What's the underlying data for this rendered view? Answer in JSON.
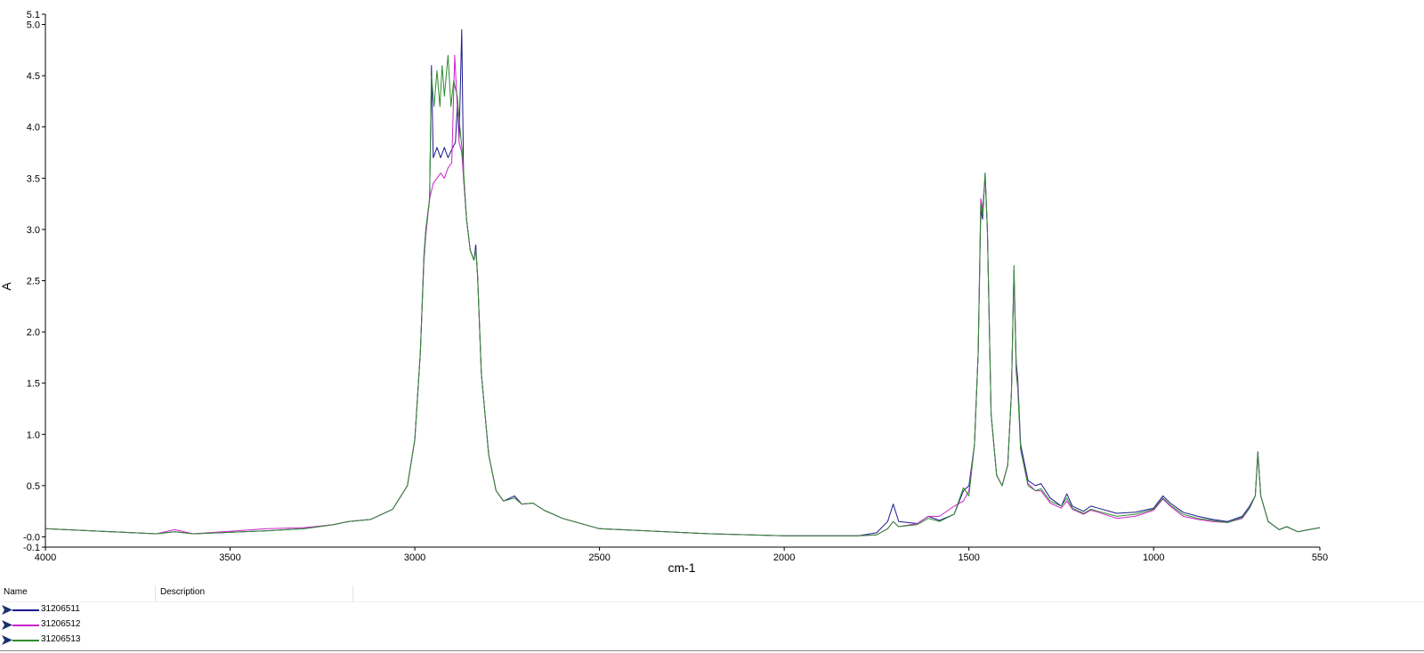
{
  "chart_data": {
    "type": "line",
    "xlabel": "cm-1",
    "ylabel": "A",
    "xlim": [
      4000,
      550
    ],
    "ylim": [
      -0.1,
      5.1
    ],
    "x_reversed": true,
    "xticks": [
      4000,
      3500,
      3000,
      2500,
      2000,
      1500,
      1000,
      550
    ],
    "xtick_labels": [
      "4000",
      "3500",
      "3000",
      "2500",
      "2000",
      "1500",
      "1000",
      "550"
    ],
    "yticks": [
      5.1,
      5.0,
      4.5,
      4.0,
      3.5,
      3.0,
      2.5,
      2.0,
      1.5,
      1.0,
      0.5,
      0.0,
      -0.1
    ],
    "ytick_labels": [
      "5.1",
      "5.0",
      "4.5",
      "4.0",
      "3.5",
      "3.0",
      "2.5",
      "2.0",
      "1.5",
      "1.0",
      "0.5",
      "-0.0",
      "-0.1"
    ],
    "grid": false,
    "legend_position": "bottom panel",
    "series": [
      {
        "name": "31206511",
        "color": "#1a1a8c",
        "points": [
          [
            4000,
            0.08
          ],
          [
            3700,
            0.03
          ],
          [
            3650,
            0.05
          ],
          [
            3600,
            0.03
          ],
          [
            3400,
            0.06
          ],
          [
            3300,
            0.08
          ],
          [
            3220,
            0.12
          ],
          [
            3180,
            0.15
          ],
          [
            3120,
            0.17
          ],
          [
            3060,
            0.27
          ],
          [
            3020,
            0.5
          ],
          [
            3000,
            0.95
          ],
          [
            2985,
            1.8
          ],
          [
            2975,
            2.75
          ],
          [
            2970,
            3.0
          ],
          [
            2960,
            3.3
          ],
          [
            2955,
            4.6
          ],
          [
            2950,
            3.7
          ],
          [
            2940,
            3.8
          ],
          [
            2930,
            3.7
          ],
          [
            2920,
            3.8
          ],
          [
            2910,
            3.7
          ],
          [
            2900,
            3.78
          ],
          [
            2890,
            3.85
          ],
          [
            2885,
            4.2
          ],
          [
            2880,
            3.9
          ],
          [
            2873,
            4.95
          ],
          [
            2868,
            3.5
          ],
          [
            2860,
            3.1
          ],
          [
            2850,
            2.8
          ],
          [
            2840,
            2.7
          ],
          [
            2835,
            2.85
          ],
          [
            2830,
            2.55
          ],
          [
            2820,
            1.6
          ],
          [
            2800,
            0.8
          ],
          [
            2780,
            0.45
          ],
          [
            2760,
            0.35
          ],
          [
            2730,
            0.4
          ],
          [
            2710,
            0.32
          ],
          [
            2680,
            0.33
          ],
          [
            2650,
            0.26
          ],
          [
            2600,
            0.18
          ],
          [
            2500,
            0.08
          ],
          [
            2200,
            0.03
          ],
          [
            2000,
            0.01
          ],
          [
            1800,
            0.01
          ],
          [
            1750,
            0.04
          ],
          [
            1720,
            0.15
          ],
          [
            1705,
            0.32
          ],
          [
            1690,
            0.15
          ],
          [
            1640,
            0.13
          ],
          [
            1610,
            0.2
          ],
          [
            1580,
            0.16
          ],
          [
            1540,
            0.22
          ],
          [
            1515,
            0.45
          ],
          [
            1500,
            0.5
          ],
          [
            1485,
            0.9
          ],
          [
            1475,
            1.8
          ],
          [
            1468,
            3.2
          ],
          [
            1463,
            3.1
          ],
          [
            1456,
            3.55
          ],
          [
            1450,
            3.0
          ],
          [
            1440,
            1.2
          ],
          [
            1425,
            0.6
          ],
          [
            1410,
            0.5
          ],
          [
            1395,
            0.7
          ],
          [
            1385,
            1.4
          ],
          [
            1378,
            2.6
          ],
          [
            1372,
            1.7
          ],
          [
            1368,
            1.55
          ],
          [
            1360,
            0.9
          ],
          [
            1340,
            0.55
          ],
          [
            1320,
            0.5
          ],
          [
            1305,
            0.52
          ],
          [
            1280,
            0.38
          ],
          [
            1250,
            0.3
          ],
          [
            1235,
            0.42
          ],
          [
            1220,
            0.3
          ],
          [
            1190,
            0.25
          ],
          [
            1170,
            0.3
          ],
          [
            1150,
            0.28
          ],
          [
            1100,
            0.23
          ],
          [
            1050,
            0.24
          ],
          [
            1000,
            0.28
          ],
          [
            975,
            0.4
          ],
          [
            955,
            0.33
          ],
          [
            920,
            0.24
          ],
          [
            880,
            0.2
          ],
          [
            840,
            0.17
          ],
          [
            800,
            0.15
          ],
          [
            760,
            0.2
          ],
          [
            740,
            0.3
          ],
          [
            725,
            0.4
          ],
          [
            718,
            0.83
          ],
          [
            710,
            0.4
          ],
          [
            690,
            0.15
          ],
          [
            660,
            0.07
          ],
          [
            640,
            0.1
          ],
          [
            610,
            0.05
          ],
          [
            580,
            0.07
          ],
          [
            550,
            0.09
          ]
        ]
      },
      {
        "name": "31206512",
        "color": "#cc22cc",
        "points": [
          [
            4000,
            0.08
          ],
          [
            3700,
            0.03
          ],
          [
            3650,
            0.07
          ],
          [
            3600,
            0.03
          ],
          [
            3400,
            0.08
          ],
          [
            3300,
            0.09
          ],
          [
            3220,
            0.12
          ],
          [
            3180,
            0.15
          ],
          [
            3120,
            0.17
          ],
          [
            3060,
            0.27
          ],
          [
            3020,
            0.5
          ],
          [
            3000,
            0.95
          ],
          [
            2985,
            1.8
          ],
          [
            2975,
            2.7
          ],
          [
            2970,
            2.95
          ],
          [
            2960,
            3.3
          ],
          [
            2950,
            3.45
          ],
          [
            2940,
            3.5
          ],
          [
            2930,
            3.55
          ],
          [
            2920,
            3.5
          ],
          [
            2910,
            3.6
          ],
          [
            2900,
            3.65
          ],
          [
            2892,
            4.7
          ],
          [
            2885,
            4.2
          ],
          [
            2880,
            3.85
          ],
          [
            2873,
            3.75
          ],
          [
            2868,
            3.5
          ],
          [
            2860,
            3.1
          ],
          [
            2850,
            2.8
          ],
          [
            2840,
            2.7
          ],
          [
            2835,
            2.8
          ],
          [
            2830,
            2.55
          ],
          [
            2820,
            1.6
          ],
          [
            2800,
            0.8
          ],
          [
            2780,
            0.45
          ],
          [
            2760,
            0.35
          ],
          [
            2730,
            0.38
          ],
          [
            2710,
            0.32
          ],
          [
            2680,
            0.33
          ],
          [
            2650,
            0.26
          ],
          [
            2600,
            0.18
          ],
          [
            2500,
            0.08
          ],
          [
            2200,
            0.03
          ],
          [
            2000,
            0.01
          ],
          [
            1800,
            0.01
          ],
          [
            1750,
            0.02
          ],
          [
            1720,
            0.08
          ],
          [
            1705,
            0.15
          ],
          [
            1690,
            0.1
          ],
          [
            1640,
            0.13
          ],
          [
            1610,
            0.2
          ],
          [
            1580,
            0.2
          ],
          [
            1540,
            0.3
          ],
          [
            1515,
            0.35
          ],
          [
            1500,
            0.45
          ],
          [
            1485,
            0.9
          ],
          [
            1475,
            1.8
          ],
          [
            1468,
            3.3
          ],
          [
            1463,
            3.2
          ],
          [
            1456,
            3.5
          ],
          [
            1450,
            3.0
          ],
          [
            1440,
            1.2
          ],
          [
            1425,
            0.6
          ],
          [
            1410,
            0.5
          ],
          [
            1395,
            0.7
          ],
          [
            1385,
            1.4
          ],
          [
            1378,
            2.6
          ],
          [
            1372,
            1.65
          ],
          [
            1368,
            1.5
          ],
          [
            1360,
            0.85
          ],
          [
            1340,
            0.52
          ],
          [
            1320,
            0.45
          ],
          [
            1305,
            0.45
          ],
          [
            1280,
            0.33
          ],
          [
            1250,
            0.28
          ],
          [
            1235,
            0.35
          ],
          [
            1220,
            0.27
          ],
          [
            1190,
            0.22
          ],
          [
            1170,
            0.26
          ],
          [
            1150,
            0.24
          ],
          [
            1100,
            0.18
          ],
          [
            1050,
            0.2
          ],
          [
            1000,
            0.26
          ],
          [
            975,
            0.37
          ],
          [
            955,
            0.3
          ],
          [
            920,
            0.2
          ],
          [
            880,
            0.17
          ],
          [
            840,
            0.15
          ],
          [
            800,
            0.14
          ],
          [
            760,
            0.18
          ],
          [
            740,
            0.28
          ],
          [
            725,
            0.4
          ],
          [
            718,
            0.8
          ],
          [
            710,
            0.4
          ],
          [
            690,
            0.15
          ],
          [
            660,
            0.07
          ],
          [
            640,
            0.1
          ],
          [
            610,
            0.05
          ],
          [
            580,
            0.07
          ],
          [
            550,
            0.09
          ]
        ]
      },
      {
        "name": "31206513",
        "color": "#2e8b2e",
        "points": [
          [
            4000,
            0.08
          ],
          [
            3700,
            0.03
          ],
          [
            3650,
            0.05
          ],
          [
            3600,
            0.03
          ],
          [
            3400,
            0.06
          ],
          [
            3300,
            0.08
          ],
          [
            3220,
            0.12
          ],
          [
            3180,
            0.15
          ],
          [
            3120,
            0.17
          ],
          [
            3060,
            0.27
          ],
          [
            3020,
            0.5
          ],
          [
            3000,
            0.95
          ],
          [
            2985,
            1.8
          ],
          [
            2975,
            2.75
          ],
          [
            2970,
            3.0
          ],
          [
            2960,
            3.3
          ],
          [
            2955,
            4.5
          ],
          [
            2948,
            4.2
          ],
          [
            2940,
            4.55
          ],
          [
            2932,
            4.2
          ],
          [
            2926,
            4.6
          ],
          [
            2920,
            4.3
          ],
          [
            2910,
            4.7
          ],
          [
            2902,
            4.2
          ],
          [
            2895,
            4.45
          ],
          [
            2885,
            4.3
          ],
          [
            2878,
            4.0
          ],
          [
            2870,
            3.7
          ],
          [
            2860,
            3.1
          ],
          [
            2850,
            2.8
          ],
          [
            2840,
            2.7
          ],
          [
            2835,
            2.8
          ],
          [
            2830,
            2.55
          ],
          [
            2820,
            1.6
          ],
          [
            2800,
            0.8
          ],
          [
            2780,
            0.45
          ],
          [
            2760,
            0.35
          ],
          [
            2730,
            0.38
          ],
          [
            2710,
            0.32
          ],
          [
            2680,
            0.33
          ],
          [
            2650,
            0.26
          ],
          [
            2600,
            0.18
          ],
          [
            2500,
            0.08
          ],
          [
            2200,
            0.03
          ],
          [
            2000,
            0.01
          ],
          [
            1800,
            0.01
          ],
          [
            1750,
            0.02
          ],
          [
            1720,
            0.08
          ],
          [
            1705,
            0.15
          ],
          [
            1690,
            0.1
          ],
          [
            1640,
            0.12
          ],
          [
            1610,
            0.18
          ],
          [
            1580,
            0.15
          ],
          [
            1540,
            0.22
          ],
          [
            1515,
            0.48
          ],
          [
            1500,
            0.4
          ],
          [
            1485,
            0.9
          ],
          [
            1475,
            1.8
          ],
          [
            1468,
            3.25
          ],
          [
            1463,
            3.15
          ],
          [
            1456,
            3.55
          ],
          [
            1450,
            3.0
          ],
          [
            1440,
            1.2
          ],
          [
            1425,
            0.6
          ],
          [
            1410,
            0.5
          ],
          [
            1395,
            0.7
          ],
          [
            1385,
            1.4
          ],
          [
            1378,
            2.65
          ],
          [
            1372,
            1.6
          ],
          [
            1368,
            1.45
          ],
          [
            1360,
            0.85
          ],
          [
            1340,
            0.5
          ],
          [
            1320,
            0.45
          ],
          [
            1305,
            0.47
          ],
          [
            1280,
            0.35
          ],
          [
            1250,
            0.3
          ],
          [
            1235,
            0.38
          ],
          [
            1220,
            0.28
          ],
          [
            1190,
            0.23
          ],
          [
            1170,
            0.27
          ],
          [
            1150,
            0.25
          ],
          [
            1100,
            0.2
          ],
          [
            1050,
            0.22
          ],
          [
            1000,
            0.27
          ],
          [
            975,
            0.38
          ],
          [
            955,
            0.31
          ],
          [
            920,
            0.22
          ],
          [
            880,
            0.18
          ],
          [
            840,
            0.16
          ],
          [
            800,
            0.14
          ],
          [
            760,
            0.19
          ],
          [
            740,
            0.28
          ],
          [
            725,
            0.4
          ],
          [
            718,
            0.82
          ],
          [
            710,
            0.4
          ],
          [
            690,
            0.15
          ],
          [
            660,
            0.07
          ],
          [
            640,
            0.1
          ],
          [
            610,
            0.05
          ],
          [
            580,
            0.07
          ],
          [
            550,
            0.09
          ]
        ]
      }
    ]
  },
  "legend": {
    "col_name": "Name",
    "col_description": "Description",
    "items": [
      {
        "name": "31206511",
        "color": "#1a1a8c"
      },
      {
        "name": "31206512",
        "color": "#cc22cc"
      },
      {
        "name": "31206513",
        "color": "#2e8b2e"
      }
    ]
  }
}
